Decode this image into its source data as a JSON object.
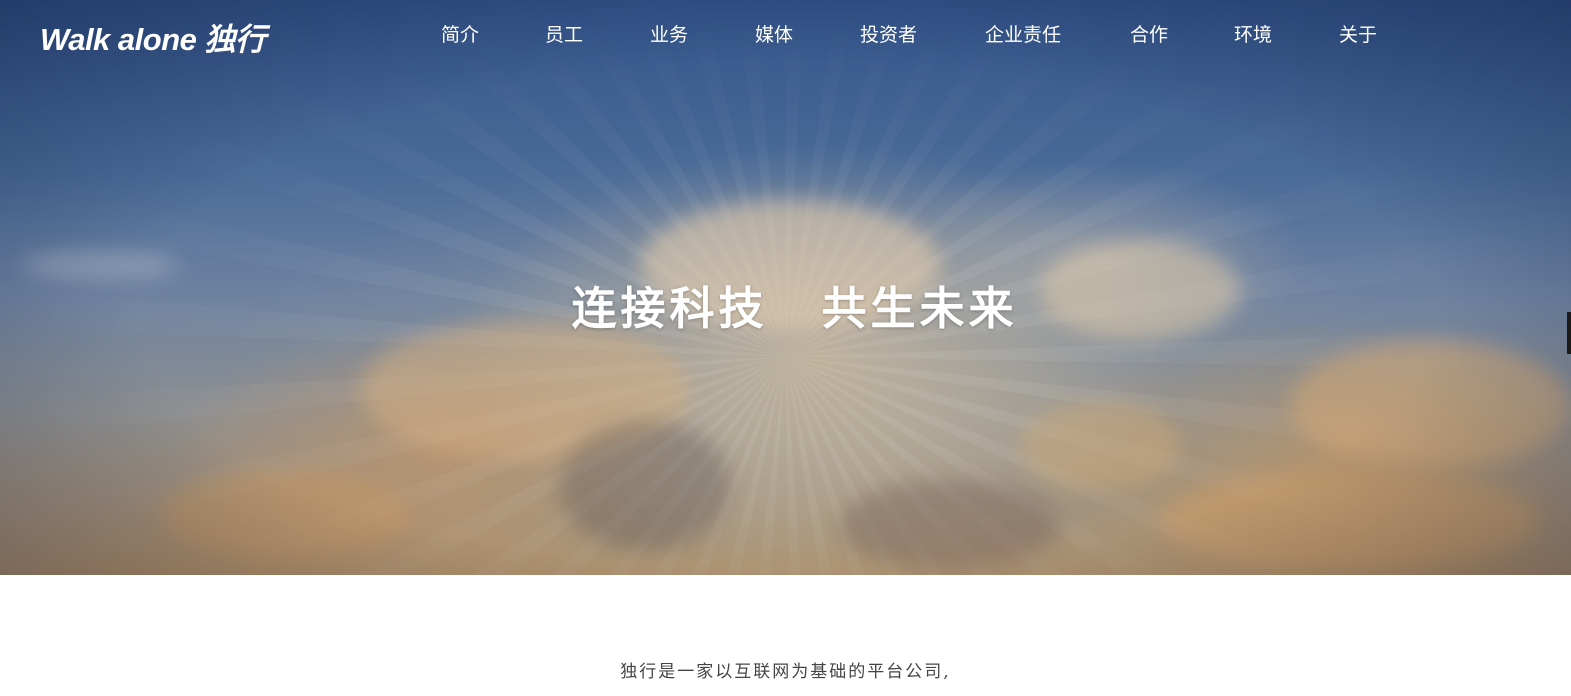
{
  "header": {
    "logo_text": "Walk alone 独行",
    "nav_items": [
      {
        "label": "简介"
      },
      {
        "label": "员工"
      },
      {
        "label": "业务"
      },
      {
        "label": "媒体"
      },
      {
        "label": "投资者"
      },
      {
        "label": "企业责任"
      },
      {
        "label": "合作"
      },
      {
        "label": "环境"
      },
      {
        "label": "关于"
      }
    ]
  },
  "hero": {
    "headline_left": "连接科技",
    "headline_right": "共生未来"
  },
  "intro": {
    "text": "独行是一家以互联网为基础的平台公司,"
  },
  "colors": {
    "sky_top": "#34548a",
    "sky_horizon": "#b28e64",
    "nav_text": "#ffffff",
    "body_text": "#444444"
  }
}
